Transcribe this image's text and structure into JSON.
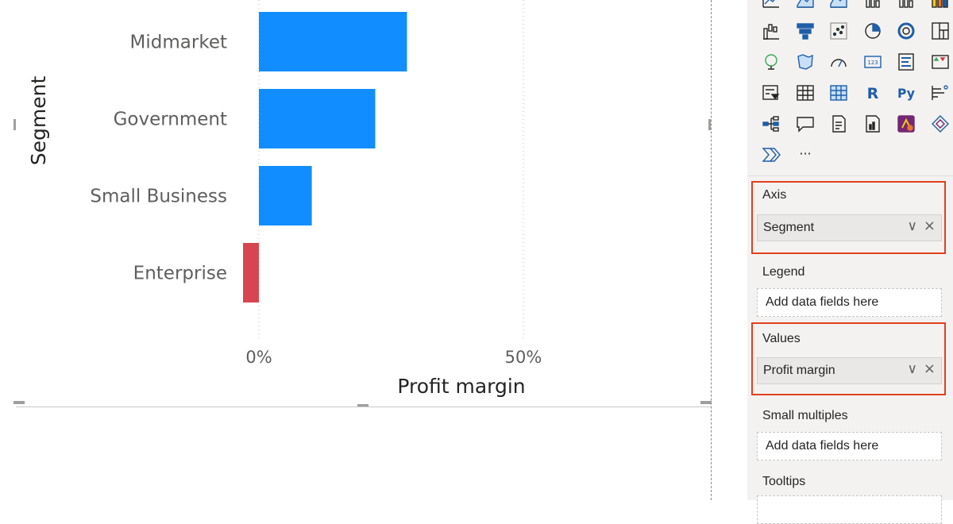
{
  "chart_data": {
    "type": "bar",
    "orientation": "horizontal",
    "categories": [
      "Midmarket",
      "Government",
      "Small Business",
      "Enterprise"
    ],
    "values": [
      28,
      22,
      10,
      -3
    ],
    "xlabel": "Profit margin",
    "ylabel": "Segment",
    "x_ticks": [
      "0%",
      "50%"
    ],
    "xlim": [
      -50,
      80
    ],
    "grid": "vertical dotted",
    "colors": {
      "positive": "#118dff",
      "negative": "#d64550"
    }
  },
  "pane": {
    "gallery_icons": [
      "line-chart-icon",
      "area-chart-icon",
      "stacked-area-icon",
      "line-clustered-column-icon",
      "line-stacked-column-icon",
      "ribbon-chart-icon",
      "waterfall-chart-icon",
      "funnel-icon",
      "scatter-chart-icon",
      "pie-chart-icon",
      "donut-chart-icon",
      "treemap-icon",
      "map-icon",
      "filled-map-icon",
      "gauge-icon",
      "card-icon",
      "multi-row-card-icon",
      "kpi-icon",
      "slicer-icon",
      "table-icon",
      "matrix-icon",
      "r-visual-icon",
      "python-visual-icon",
      "key-influencers-icon",
      "decomposition-tree-icon",
      "qa-icon",
      "smart-narrative-icon",
      "paginated-report-icon",
      "power-apps-icon",
      "power-automate-icon",
      "power-automate-flow-icon",
      "more-visuals-icon"
    ],
    "r_label": "R",
    "py_label": "Py",
    "more_label": "···",
    "wells": {
      "axis": {
        "title": "Axis",
        "field": "Segment"
      },
      "legend": {
        "title": "Legend",
        "placeholder": "Add data fields here"
      },
      "values": {
        "title": "Values",
        "field": "Profit margin"
      },
      "small_multiples": {
        "title": "Small multiples",
        "placeholder": "Add data fields here"
      },
      "tooltips": {
        "title": "Tooltips"
      }
    },
    "chevron": "∨",
    "remove": "×"
  }
}
